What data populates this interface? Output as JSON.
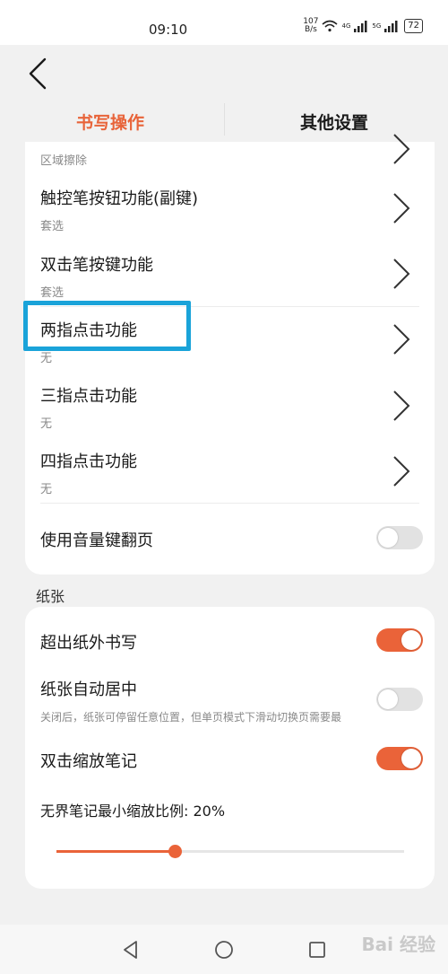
{
  "status_bar": {
    "time": "09:10",
    "net_speed_value": "107",
    "net_speed_unit": "B/s",
    "signal1_label": "4G",
    "signal2_label": "5G",
    "battery": "72"
  },
  "tabs": [
    {
      "label": "书写操作",
      "active": true
    },
    {
      "label": "其他设置",
      "active": false
    }
  ],
  "gesture_rows": [
    {
      "title": "",
      "subtitle": "区域擦除"
    },
    {
      "title": "触控笔按钮功能(副键)",
      "subtitle": "套选"
    },
    {
      "title": "双击笔按键功能",
      "subtitle": "套选"
    },
    {
      "title": "两指点击功能",
      "subtitle": "无"
    },
    {
      "title": "三指点击功能",
      "subtitle": "无"
    },
    {
      "title": "四指点击功能",
      "subtitle": "无"
    }
  ],
  "volume_toggle": {
    "label": "使用音量键翻页",
    "on": false
  },
  "paper_section": {
    "label": "纸张",
    "items": [
      {
        "label": "超出纸外书写",
        "on": true
      },
      {
        "label": "纸张自动居中",
        "description": "关闭后，纸张可停留任意位置，但单页模式下滑动切换页需要最",
        "on": false
      },
      {
        "label": "双击缩放笔记",
        "on": true
      }
    ],
    "zoom": {
      "label": "无界笔记最小缩放比例: 20%",
      "value_fraction": 0.34
    }
  },
  "colors": {
    "accent": "#ea6339",
    "highlight": "#1aa3d9"
  },
  "watermark": "Bai 经验"
}
